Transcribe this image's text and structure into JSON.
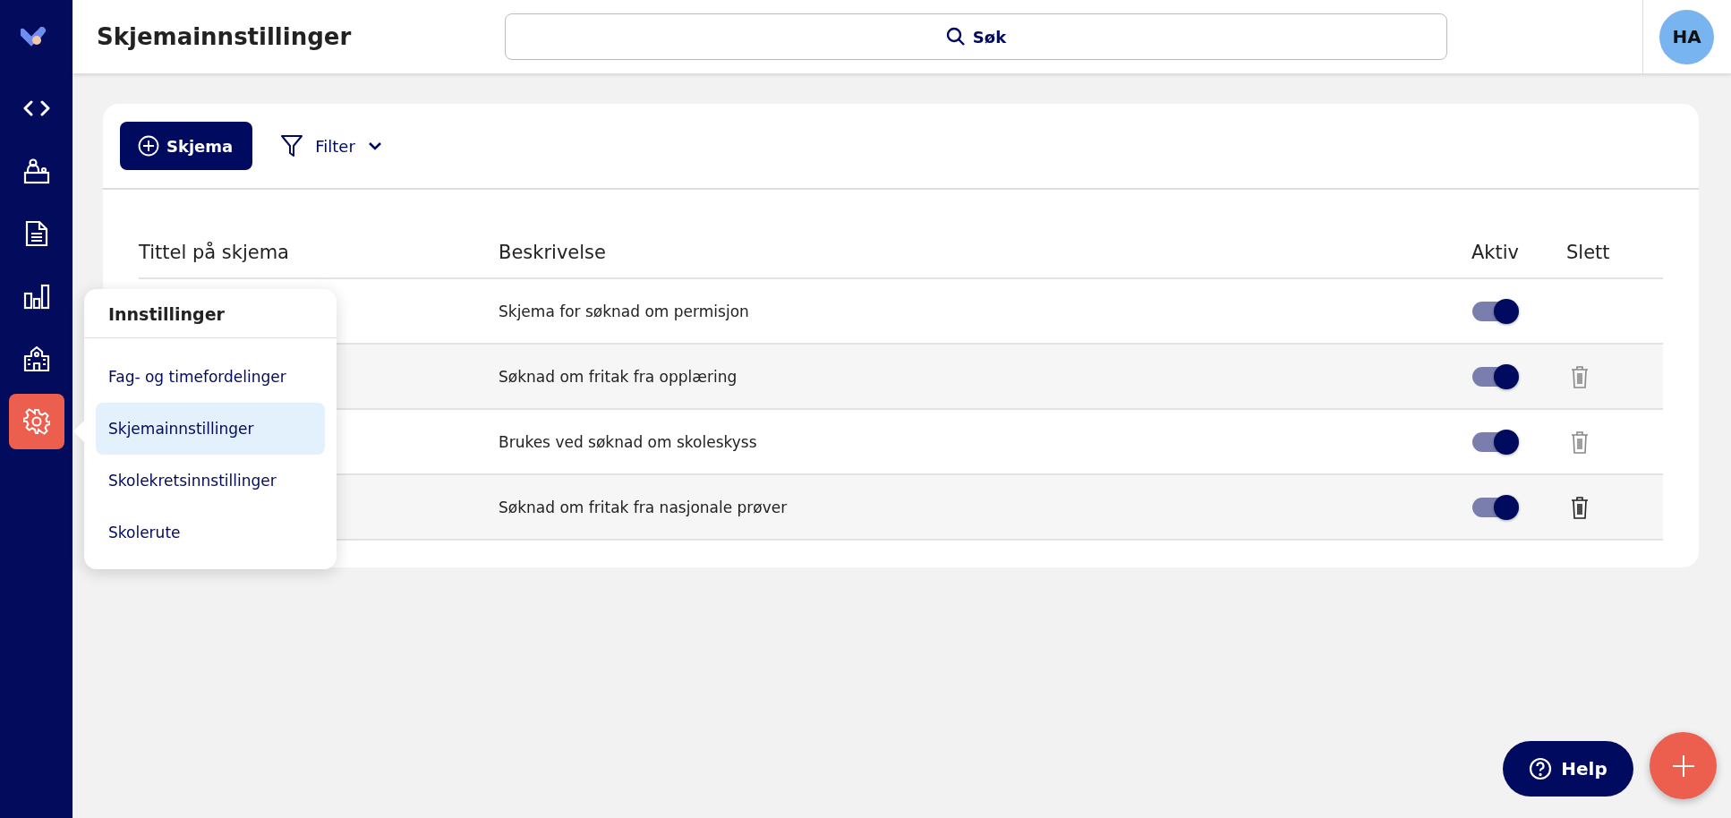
{
  "header": {
    "title": "Skjemainnstillinger",
    "search": {
      "placeholder": "Søk"
    },
    "avatar": {
      "initials": "HA"
    }
  },
  "sidebar": {
    "items": [
      {
        "kind": "code",
        "selected": false
      },
      {
        "kind": "desk",
        "selected": false
      },
      {
        "kind": "document",
        "selected": false
      },
      {
        "kind": "chart",
        "selected": false
      },
      {
        "kind": "school",
        "selected": false
      },
      {
        "kind": "settings",
        "selected": true
      }
    ]
  },
  "toolbar": {
    "new_button": "Skjema",
    "filter": "Filter"
  },
  "table": {
    "columns": [
      "Tittel på skjema",
      "Beskrivelse",
      "Aktiv",
      "Slett"
    ],
    "rows": [
      {
        "description": "Skjema for søknad om permisjon",
        "active": true
      },
      {
        "description": "Søknad om fritak fra opplæring",
        "active": true,
        "delete": {
          "disabled": true
        }
      },
      {
        "description": "Brukes ved søknad om skoleskyss",
        "active": true,
        "delete": {
          "disabled": true
        }
      },
      {
        "description": "Søknad om fritak fra nasjonale prøver",
        "active": true,
        "delete": {
          "disabled": false
        }
      }
    ]
  },
  "settings_menu": {
    "title": "Innstillinger",
    "items": [
      {
        "label": "Fag- og timefordelinger",
        "selected": false
      },
      {
        "label": "Skjemainnstillinger",
        "selected": true
      },
      {
        "label": "Skolekretsinnstillinger",
        "selected": false
      },
      {
        "label": "Skolerute",
        "selected": false
      }
    ]
  },
  "help_button": {
    "label": "Help"
  }
}
